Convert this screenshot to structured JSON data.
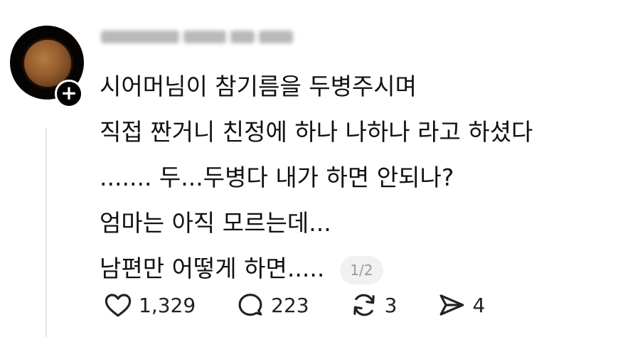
{
  "post": {
    "lines": [
      "시어머님이 참기름을 두병주시며",
      "직접 짠거니 친정에 하나 나하나 라고 하셨다",
      "....... 두...두병다 내가 하면 안되나?",
      "엄마는 아직 모르는데...",
      "남편만 어떻게 하면....."
    ],
    "page_indicator": "1/2"
  },
  "avatar": {
    "follow_symbol": "+"
  },
  "actions": {
    "like_count": "1,329",
    "reply_count": "223",
    "repost_count": "3",
    "share_count": "4"
  },
  "icons": {
    "like": "heart-icon",
    "reply": "comment-bubble-icon",
    "repost": "repost-arrows-icon",
    "share": "send-paper-plane-icon"
  },
  "colors": {
    "background": "#ffffff",
    "text": "#111111",
    "indicator_bg": "#f1f1f1",
    "indicator_text": "#9a9a9a",
    "follow_button": "#000000"
  }
}
